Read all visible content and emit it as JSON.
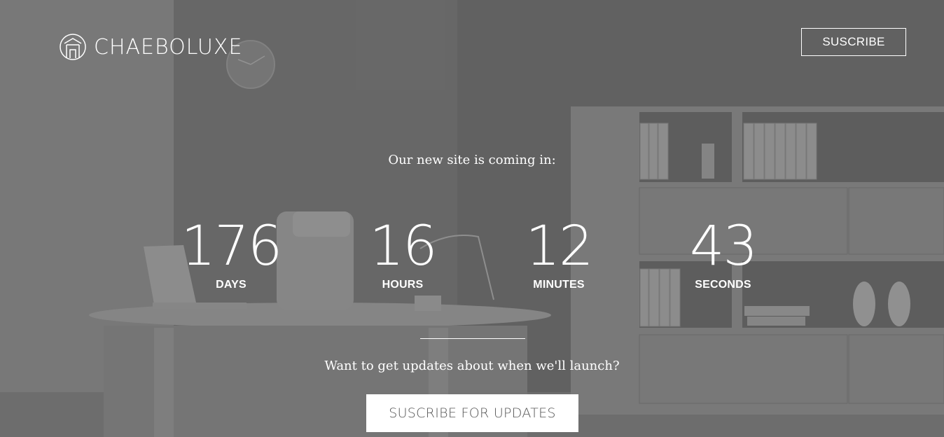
{
  "brand": {
    "name": "CHAEBOLUXE",
    "logo_icon": "home-ring-icon"
  },
  "header": {
    "subscribe_label": "SUSCRIBE"
  },
  "hero": {
    "tagline": "Our new site is coming in:",
    "countdown": [
      {
        "value": "176",
        "label": "DAYS"
      },
      {
        "value": "16",
        "label": "HOURS"
      },
      {
        "value": "12",
        "label": "MINUTES"
      },
      {
        "value": "43",
        "label": "SECONDS"
      }
    ],
    "updates_prompt": "Want to get updates about when we'll launch?",
    "updates_button_label": "SUSCRIBE FOR UPDATES"
  },
  "colors": {
    "text": "#ffffff",
    "background": "#6f6f6f",
    "button_bg": "#ffffff",
    "button_text": "#555555"
  }
}
